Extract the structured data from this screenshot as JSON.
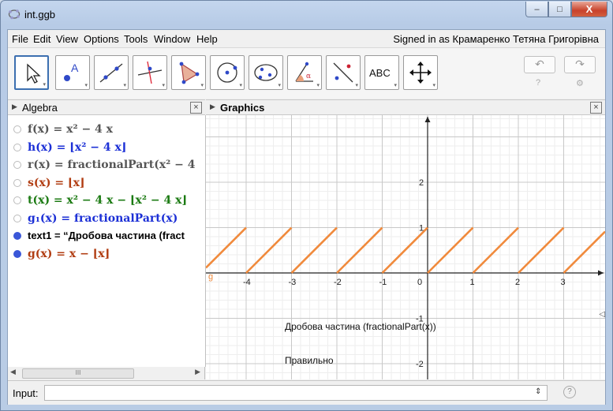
{
  "window": {
    "title": "int.ggb",
    "min_label": "–",
    "max_label": "□",
    "close_label": "X"
  },
  "menu": {
    "items": [
      "File",
      "Edit",
      "View",
      "Options",
      "Tools",
      "Window",
      "Help"
    ],
    "signed_in": "Signed in as Крамаренко Тетяна Григорівна"
  },
  "toolbar": {
    "tools": [
      "move-tool",
      "point-tool",
      "line-tool",
      "perpendicular-tool",
      "polygon-tool",
      "circle-tool",
      "conic-tool",
      "angle-tool",
      "reflect-tool",
      "text-tool",
      "move-view-tool"
    ],
    "text_tool_label": "ABC",
    "undo_label": "↶",
    "redo_label": "↷",
    "help_label": "?",
    "settings_label": "⚙"
  },
  "algebra": {
    "header": "Algebra",
    "rows": [
      {
        "expr": "f(x) = x² − 4 x",
        "color": "#555555",
        "shown": false
      },
      {
        "expr": "h(x) = ⌊x² − 4 x⌋",
        "color": "#1b2fd6",
        "shown": false
      },
      {
        "expr": "r(x) = fractionalPart(x² − 4",
        "color": "#555555",
        "shown": false
      },
      {
        "expr": "s(x) = ⌊x⌋",
        "color": "#b13d12",
        "shown": false
      },
      {
        "expr": "t(x) = x² − 4 x − ⌊x² − 4 x⌋",
        "color": "#1b7a12",
        "shown": false
      },
      {
        "expr": "g₁(x) = fractionalPart(x)",
        "color": "#1b2fd6",
        "shown": false
      },
      {
        "expr": "text1 = “Дробова частина  (fract",
        "color": "#000000",
        "shown": true
      },
      {
        "expr": "g(x) = x − ⌊x⌋",
        "color": "#b13d12",
        "shown": true
      }
    ],
    "scroll_thumb": "III"
  },
  "graphics": {
    "header": "Graphics",
    "text1": "Дробова частина  (fractionalPart(x))",
    "text2": "Правильно",
    "curve_label": "g",
    "x_ticks": [
      "-4",
      "-3",
      "-2",
      "-1",
      "0",
      "1",
      "2",
      "3"
    ],
    "y_ticks": [
      "2",
      "1",
      "-1",
      "-2"
    ],
    "curve_color": "#f08a3c"
  },
  "input": {
    "label": "Input:",
    "value": "",
    "spin": "⇕",
    "help": "?"
  }
}
